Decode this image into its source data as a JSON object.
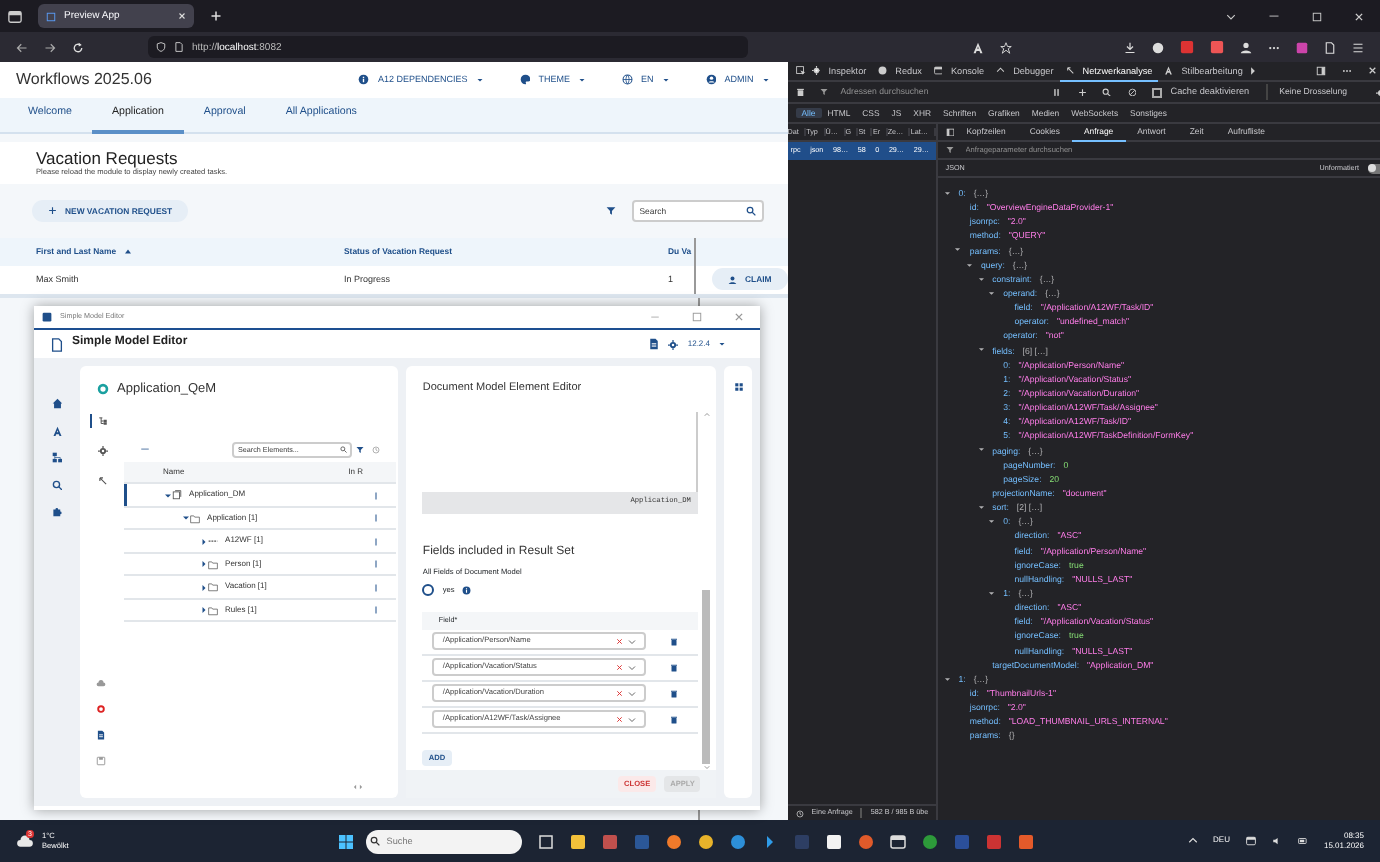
{
  "browser": {
    "tab_title": "Preview App",
    "url": "http://**localhost**:8082"
  },
  "app": {
    "title": "Workflows 2025.06",
    "menus": [
      {
        "label": "A12 DEPENDENCIES"
      },
      {
        "label": "THEME"
      },
      {
        "label": "EN"
      },
      {
        "label": "ADMIN"
      }
    ],
    "tabs": [
      {
        "label": "Welcome",
        "selected": false
      },
      {
        "label": "Application",
        "selected": true
      },
      {
        "label": "Approval",
        "selected": false
      },
      {
        "label": "All Applications",
        "selected": false
      }
    ],
    "heading": "Vacation Requests",
    "subtitle": "Please reload the module to display newly created tasks.",
    "new_button": "NEW VACATION REQUEST",
    "search": {
      "placeholder": "Search"
    },
    "table": {
      "columns": [
        {
          "label": "First and Last Name",
          "sorted": true
        },
        {
          "label": "Status of Vacation Request",
          "sorted": false
        },
        {
          "label": "Du Va",
          "sorted": false
        }
      ],
      "rows": [
        {
          "cells": [
            "Max Smith",
            "In Progress",
            "1"
          ],
          "action": "CLAIM"
        }
      ]
    }
  },
  "editor": {
    "window_title": "Simple Model Editor",
    "app_title": "Simple Model Editor",
    "version": "12.2.4",
    "model_name": "Application_QeM",
    "side_tabs": [
      {
        "kind": "tree",
        "selected": true
      },
      {
        "kind": "gear",
        "selected": false
      },
      {
        "kind": "branch",
        "selected": false
      }
    ],
    "search_placeholder": "Search Elements...",
    "tree_columns": [
      "Name",
      "In R"
    ],
    "tree": [
      {
        "label": "Application_DM",
        "kind": "model",
        "expanded": true,
        "selected": true,
        "children": [
          {
            "label": "Application [1]",
            "kind": "folder",
            "expanded": true,
            "selected": false,
            "children": [
              {
                "label": "A12WF [1]",
                "kind": "link",
                "expanded": false,
                "selected": false
              },
              {
                "label": "Person [1]",
                "kind": "folder",
                "expanded": false,
                "selected": false
              },
              {
                "label": "Vacation [1]",
                "kind": "folder",
                "expanded": false,
                "selected": false
              },
              {
                "label": "Rules [1]",
                "kind": "folder",
                "expanded": false,
                "selected": false
              }
            ]
          }
        ]
      }
    ],
    "editor_title": "Document Model Element Editor",
    "code_text": "Application_DM",
    "section_title": "Fields included in Result Set",
    "all_fields_label": "All Fields of Document Model",
    "all_fields_option": {
      "label": "yes",
      "checked": false
    },
    "field_header": "Field*",
    "fields": [
      "/Application/Person/Name",
      "/Application/Vacation/Status",
      "/Application/Vacation/Duration",
      "/Application/A12WF/Task/Assignee"
    ],
    "add_button": "ADD",
    "close_button": "CLOSE",
    "apply_button": {
      "label": "APPLY",
      "disabled": true
    }
  },
  "devtools": {
    "tools": [
      {
        "label": "Inspektor",
        "selected": false
      },
      {
        "label": "Redux",
        "selected": false
      },
      {
        "label": "Konsole",
        "selected": false
      },
      {
        "label": "Debugger",
        "selected": false
      },
      {
        "label": "Netzwerkanalyse",
        "selected": true
      },
      {
        "label": "Stilbearbeitung",
        "selected": false
      }
    ],
    "filter_placeholder": "Adressen durchsuchen",
    "cache_label": "Cache deaktivieren",
    "cache_checked": false,
    "throttle": "Keine Drosselung",
    "types": [
      {
        "label": "Alle",
        "selected": true
      },
      {
        "label": "HTML",
        "selected": false
      },
      {
        "label": "CSS",
        "selected": false
      },
      {
        "label": "JS",
        "selected": false
      },
      {
        "label": "XHR",
        "selected": false
      },
      {
        "label": "Schriften",
        "selected": false
      },
      {
        "label": "Grafiken",
        "selected": false
      },
      {
        "label": "Medien",
        "selected": false
      },
      {
        "label": "WebSockets",
        "selected": false
      },
      {
        "label": "Sonstiges",
        "selected": false
      }
    ],
    "list_columns": [
      "Dat",
      "Typ",
      "Ü…",
      "G",
      "St",
      "Er",
      "Ze…",
      "Lat…"
    ],
    "requests": [
      {
        "cells": [
          "rpc",
          "json",
          "98…",
          "58",
          "0",
          "29…",
          "29…"
        ],
        "selected": true
      }
    ],
    "detail_tabs": [
      {
        "label": "Kopfzeilen",
        "selected": false
      },
      {
        "label": "Cookies",
        "selected": false
      },
      {
        "label": "Anfrage",
        "selected": true
      },
      {
        "label": "Antwort",
        "selected": false
      },
      {
        "label": "Zeit",
        "selected": false
      },
      {
        "label": "Aufrufliste",
        "selected": false
      }
    ],
    "param_filter_placeholder": "Anfrageparameter durchsuchen",
    "json_label": "JSON",
    "raw_label": "Unformatiert",
    "raw_on": false,
    "tree": [
      {
        "key": "0:",
        "value": "{…}",
        "kind": "summary",
        "expanded": true,
        "children": [
          {
            "key": "id:",
            "value": "\"OverviewEngineDataProvider-1\"",
            "kind": "string"
          },
          {
            "key": "jsonrpc:",
            "value": "\"2.0\"",
            "kind": "string"
          },
          {
            "key": "method:",
            "value": "\"QUERY\"",
            "kind": "string"
          },
          {
            "key": "params:",
            "value": "{…}",
            "kind": "summary",
            "expanded": true,
            "children": [
              {
                "key": "query:",
                "value": "{…}",
                "kind": "summary",
                "expanded": true,
                "children": [
                  {
                    "key": "constraint:",
                    "value": "{…}",
                    "kind": "summary",
                    "expanded": true,
                    "children": [
                      {
                        "key": "operand:",
                        "value": "{…}",
                        "kind": "summary",
                        "expanded": true,
                        "children": [
                          {
                            "key": "field:",
                            "value": "\"/Application/A12WF/Task/ID\"",
                            "kind": "string"
                          },
                          {
                            "key": "operator:",
                            "value": "\"undefined_match\"",
                            "kind": "string"
                          }
                        ]
                      },
                      {
                        "key": "operator:",
                        "value": "\"not\"",
                        "kind": "string"
                      }
                    ]
                  },
                  {
                    "key": "fields:",
                    "value": "[6] […]",
                    "kind": "summary",
                    "expanded": true,
                    "children": [
                      {
                        "key": "0:",
                        "value": "\"/Application/Person/Name\"",
                        "kind": "string"
                      },
                      {
                        "key": "1:",
                        "value": "\"/Application/Vacation/Status\"",
                        "kind": "string"
                      },
                      {
                        "key": "2:",
                        "value": "\"/Application/Vacation/Duration\"",
                        "kind": "string"
                      },
                      {
                        "key": "3:",
                        "value": "\"/Application/A12WF/Task/Assignee\"",
                        "kind": "string"
                      },
                      {
                        "key": "4:",
                        "value": "\"/Application/A12WF/Task/ID\"",
                        "kind": "string"
                      },
                      {
                        "key": "5:",
                        "value": "\"/Application/A12WF/TaskDefinition/FormKey\"",
                        "kind": "string"
                      }
                    ]
                  },
                  {
                    "key": "paging:",
                    "value": "{…}",
                    "kind": "summary",
                    "expanded": true,
                    "children": [
                      {
                        "key": "pageNumber:",
                        "value": "0",
                        "kind": "number"
                      },
                      {
                        "key": "pageSize:",
                        "value": "20",
                        "kind": "number"
                      }
                    ]
                  },
                  {
                    "key": "projectionName:",
                    "value": "\"document\"",
                    "kind": "string"
                  },
                  {
                    "key": "sort:",
                    "value": "[2] […]",
                    "kind": "summary",
                    "expanded": true,
                    "children": [
                      {
                        "key": "0:",
                        "value": "{…}",
                        "kind": "summary",
                        "expanded": true,
                        "children": [
                          {
                            "key": "direction:",
                            "value": "\"ASC\"",
                            "kind": "string"
                          },
                          {
                            "key": "field:",
                            "value": "\"/Application/Person/Name\"",
                            "kind": "string"
                          },
                          {
                            "key": "ignoreCase:",
                            "value": "true",
                            "kind": "number"
                          },
                          {
                            "key": "nullHandling:",
                            "value": "\"NULLS_LAST\"",
                            "kind": "string"
                          }
                        ]
                      },
                      {
                        "key": "1:",
                        "value": "{…}",
                        "kind": "summary",
                        "expanded": true,
                        "children": [
                          {
                            "key": "direction:",
                            "value": "\"ASC\"",
                            "kind": "string"
                          },
                          {
                            "key": "field:",
                            "value": "\"/Application/Vacation/Status\"",
                            "kind": "string"
                          },
                          {
                            "key": "ignoreCase:",
                            "value": "true",
                            "kind": "number"
                          },
                          {
                            "key": "nullHandling:",
                            "value": "\"NULLS_LAST\"",
                            "kind": "string"
                          }
                        ]
                      }
                    ]
                  },
                  {
                    "key": "targetDocumentModel:",
                    "value": "\"Application_DM\"",
                    "kind": "string"
                  }
                ]
              }
            ]
          }
        ]
      },
      {
        "key": "1:",
        "value": "{…}",
        "kind": "summary",
        "expanded": true,
        "children": [
          {
            "key": "id:",
            "value": "\"ThumbnailUrls-1\"",
            "kind": "string"
          },
          {
            "key": "jsonrpc:",
            "value": "\"2.0\"",
            "kind": "string"
          },
          {
            "key": "method:",
            "value": "\"LOAD_THUMBNAIL_URLS_INTERNAL\"",
            "kind": "string"
          },
          {
            "key": "params:",
            "value": "{}",
            "kind": "summary"
          }
        ]
      }
    ],
    "status": [
      "Eine Anfrage",
      "582 B / 985 B übe"
    ]
  },
  "taskbar": {
    "weather": {
      "badge": "3",
      "temp": "1°C",
      "condition": "Bewölkt"
    },
    "search_placeholder": "Suche",
    "language": "DEU",
    "time": "08:35",
    "date": "15.01.2026"
  }
}
